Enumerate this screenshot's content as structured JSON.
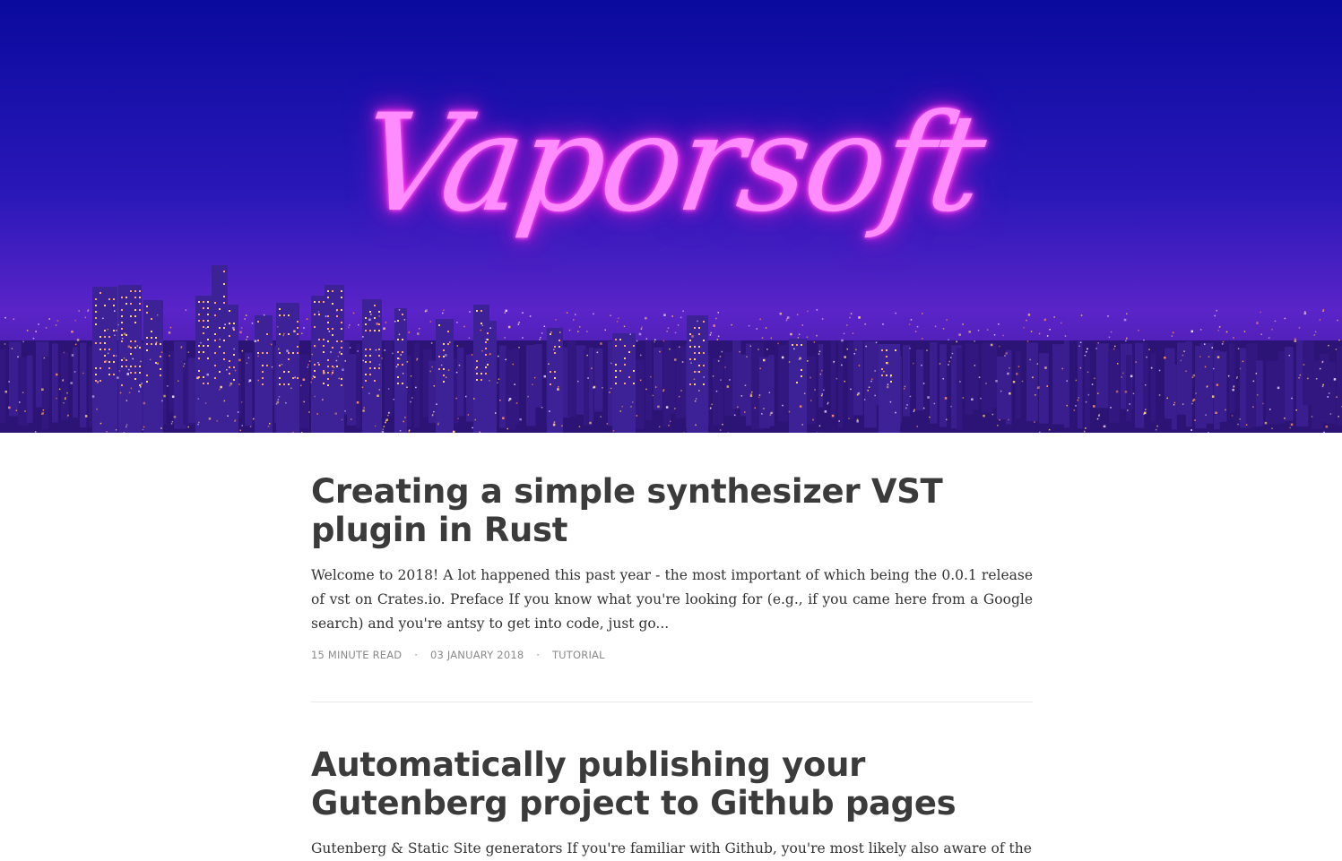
{
  "site": {
    "logo_text": "Vaporsoft",
    "colors": {
      "sky_top": "#0a0a9e",
      "sky_bottom": "#5a24c8",
      "neon_pink": "#ff7cf6",
      "title_text": "#3b3b3b",
      "meta_text": "#8a8a8a",
      "divider": "#e7e7e7"
    }
  },
  "posts": [
    {
      "title": "Creating a simple synthesizer VST plugin in Rust",
      "excerpt": "Welcome to 2018! A lot happened this past year - the most important of which being the 0.0.1 release of vst on Crates.io. Preface If you know what you're looking for (e.g., if you came here from a Google search) and you're antsy to get into code, just go...",
      "read_time": "15 MINUTE READ",
      "separator": "·",
      "date": "03 JANUARY 2018",
      "category": "TUTORIAL"
    },
    {
      "title": "Automatically publishing your Gutenberg project to Github pages",
      "excerpt": "Gutenberg & Static Site generators If you're familiar with Github, you're most likely also aware of the"
    }
  ]
}
